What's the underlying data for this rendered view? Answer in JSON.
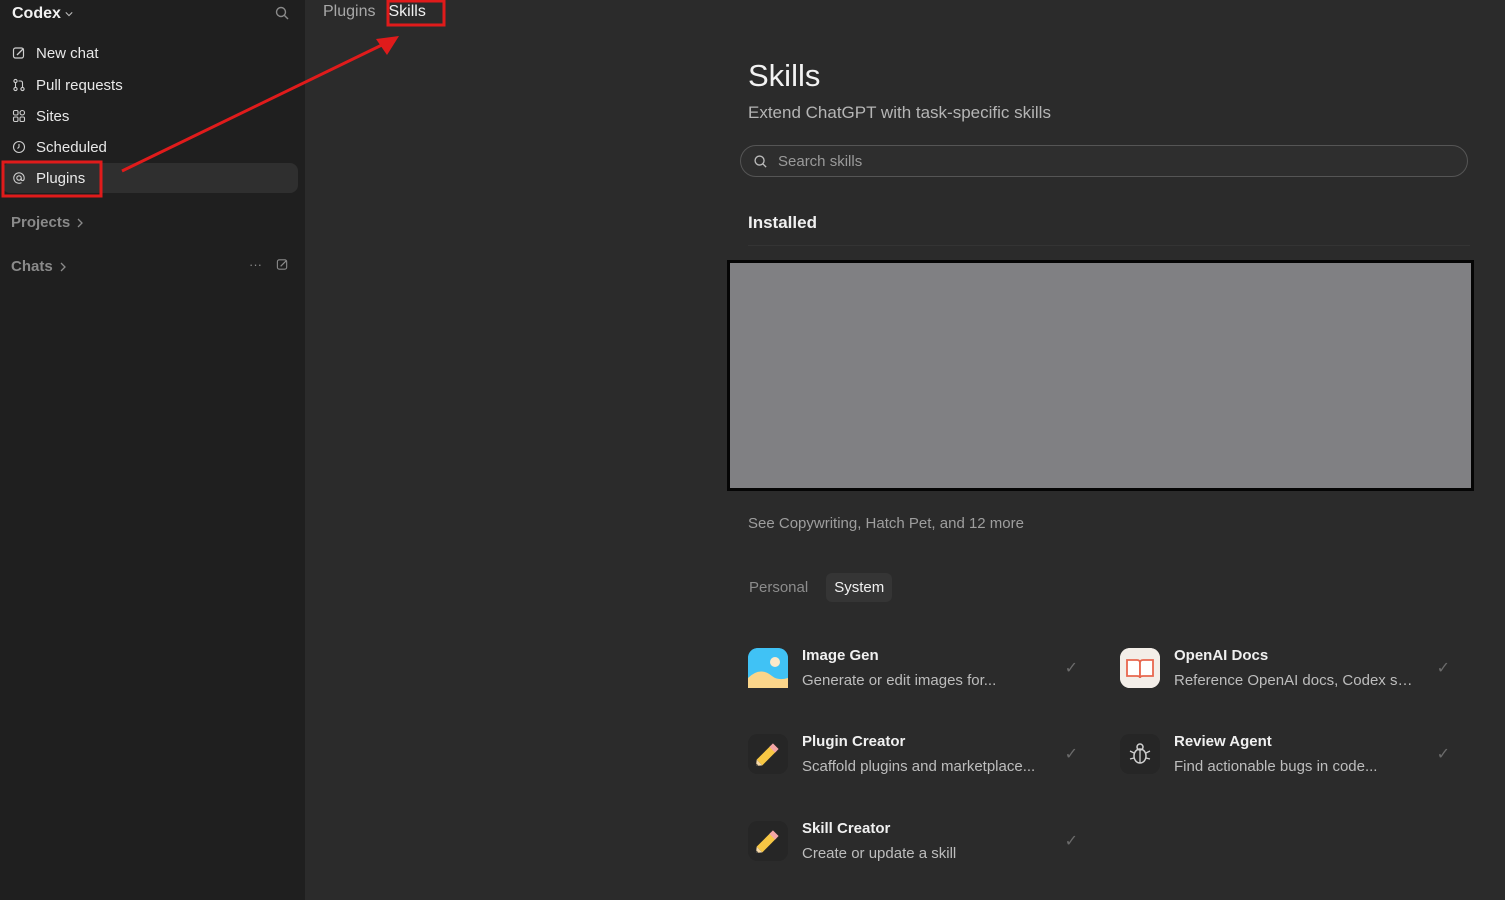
{
  "sidebar": {
    "brand": "Codex",
    "items": [
      {
        "label": "New chat",
        "icon": "edit-icon"
      },
      {
        "label": "Pull requests",
        "icon": "pull-request-icon"
      },
      {
        "label": "Sites",
        "icon": "sites-icon"
      },
      {
        "label": "Scheduled",
        "icon": "clock-icon"
      },
      {
        "label": "Plugins",
        "icon": "at-icon",
        "active": true
      }
    ],
    "projects_label": "Projects",
    "chats_label": "Chats",
    "chats_more": "···"
  },
  "breadcrumb": {
    "items": [
      "Plugins",
      "Skills"
    ]
  },
  "page": {
    "title": "Skills",
    "subtitle": "Extend ChatGPT with task-specific skills",
    "search_placeholder": "Search skills",
    "installed_heading": "Installed",
    "see_more": "See Copywriting, Hatch Pet, and 12 more",
    "tabs": [
      "Personal",
      "System"
    ],
    "selected_tab": "System"
  },
  "skills": [
    {
      "name": "Image Gen",
      "desc": "Generate or edit images for...",
      "icon": "image-gen-icon",
      "installed": true
    },
    {
      "name": "OpenAI Docs",
      "desc": "Reference OpenAI docs, Codex self...",
      "icon": "book-icon",
      "installed": true
    },
    {
      "name": "Plugin Creator",
      "desc": "Scaffold plugins and marketplace...",
      "icon": "pencil-icon",
      "installed": true
    },
    {
      "name": "Review Agent",
      "desc": "Find actionable bugs in code...",
      "icon": "bug-icon",
      "installed": true
    },
    {
      "name": "Skill Creator",
      "desc": "Create or update a skill",
      "icon": "pencil-icon",
      "installed": true
    }
  ],
  "colors": {
    "sidebar_bg": "#1f1f1f",
    "main_bg": "#2b2b2b",
    "annotation_red": "#e01b1b",
    "redacted_fill": "#808083"
  }
}
